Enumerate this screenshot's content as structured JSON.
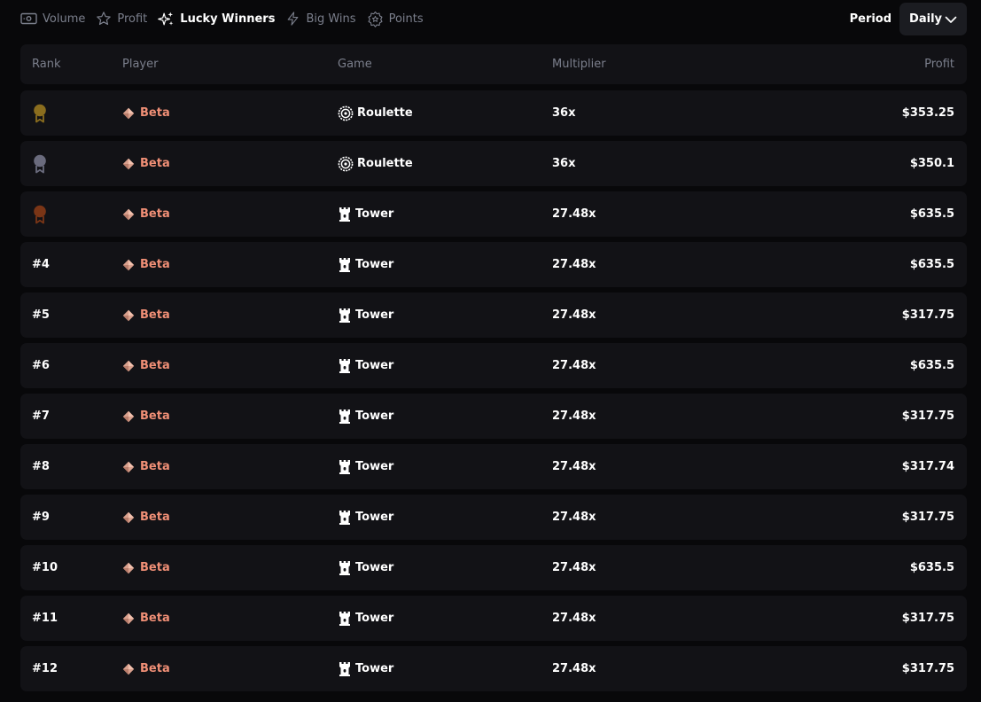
{
  "tabs": [
    {
      "label": "Volume",
      "icon": "cash-icon",
      "active": false
    },
    {
      "label": "Profit",
      "icon": "star-icon",
      "active": false
    },
    {
      "label": "Lucky Winners",
      "icon": "sparkles-icon",
      "active": true
    },
    {
      "label": "Big Wins",
      "icon": "lightning-icon",
      "active": false
    },
    {
      "label": "Points",
      "icon": "badge-star-icon",
      "active": false
    }
  ],
  "period": {
    "label": "Period",
    "selected": "Daily"
  },
  "table": {
    "headers": {
      "rank": "Rank",
      "player": "Player",
      "game": "Game",
      "multiplier": "Multiplier",
      "profit": "Profit"
    },
    "rows": [
      {
        "rank": "",
        "medal": "gold",
        "player": "Beta",
        "game": "Roulette",
        "multiplier": "36x",
        "profit": "$353.25"
      },
      {
        "rank": "",
        "medal": "silver",
        "player": "Beta",
        "game": "Roulette",
        "multiplier": "36x",
        "profit": "$350.1"
      },
      {
        "rank": "",
        "medal": "bronze",
        "player": "Beta",
        "game": "Tower",
        "multiplier": "27.48x",
        "profit": "$635.5"
      },
      {
        "rank": "#4",
        "player": "Beta",
        "game": "Tower",
        "multiplier": "27.48x",
        "profit": "$635.5"
      },
      {
        "rank": "#5",
        "player": "Beta",
        "game": "Tower",
        "multiplier": "27.48x",
        "profit": "$317.75"
      },
      {
        "rank": "#6",
        "player": "Beta",
        "game": "Tower",
        "multiplier": "27.48x",
        "profit": "$635.5"
      },
      {
        "rank": "#7",
        "player": "Beta",
        "game": "Tower",
        "multiplier": "27.48x",
        "profit": "$317.75"
      },
      {
        "rank": "#8",
        "player": "Beta",
        "game": "Tower",
        "multiplier": "27.48x",
        "profit": "$317.74"
      },
      {
        "rank": "#9",
        "player": "Beta",
        "game": "Tower",
        "multiplier": "27.48x",
        "profit": "$317.75"
      },
      {
        "rank": "#10",
        "player": "Beta",
        "game": "Tower",
        "multiplier": "27.48x",
        "profit": "$635.5"
      },
      {
        "rank": "#11",
        "player": "Beta",
        "game": "Tower",
        "multiplier": "27.48x",
        "profit": "$317.75"
      },
      {
        "rank": "#12",
        "player": "Beta",
        "game": "Tower",
        "multiplier": "27.48x",
        "profit": "$317.75"
      }
    ]
  },
  "colors": {
    "background": "#08080a",
    "row": "#121216",
    "muted_text": "#7b7f8c",
    "player_accent": "#f08f76",
    "medal_gold": "#8a6d1e",
    "medal_silver": "#6a6b7d",
    "medal_bronze": "#7a3516"
  }
}
